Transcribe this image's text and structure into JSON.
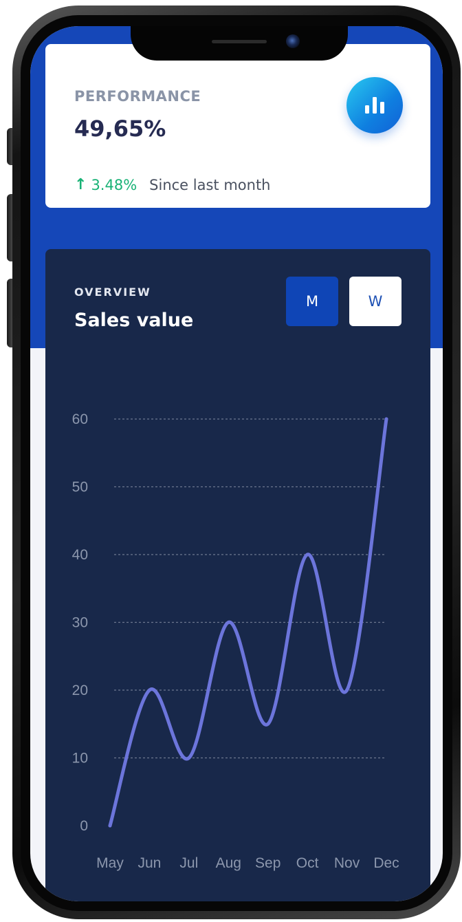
{
  "performance": {
    "label": "PERFORMANCE",
    "value": "49,65%",
    "icon": "bar-chart-icon",
    "trend": {
      "icon": "arrow-up-icon",
      "value": "3.48%",
      "since": "Since last month"
    }
  },
  "overview": {
    "label": "OVERVIEW",
    "title": "Sales value",
    "toggle": {
      "month_label": "M",
      "week_label": "W",
      "active": "M"
    }
  },
  "colors": {
    "brand_blue": "#1547b8",
    "card_dark": "#18284a",
    "line": "#6c75db",
    "positive": "#19b276"
  },
  "chart_data": {
    "type": "line",
    "categories": [
      "May",
      "Jun",
      "Jul",
      "Aug",
      "Sep",
      "Oct",
      "Nov",
      "Dec"
    ],
    "values": [
      0,
      20,
      10,
      30,
      15,
      40,
      20,
      60
    ],
    "ylim": [
      0,
      60
    ],
    "yticks": [
      0,
      10,
      20,
      30,
      40,
      50,
      60
    ],
    "grid": true,
    "curve": "smooth",
    "title": "",
    "xlabel": "",
    "ylabel": ""
  }
}
